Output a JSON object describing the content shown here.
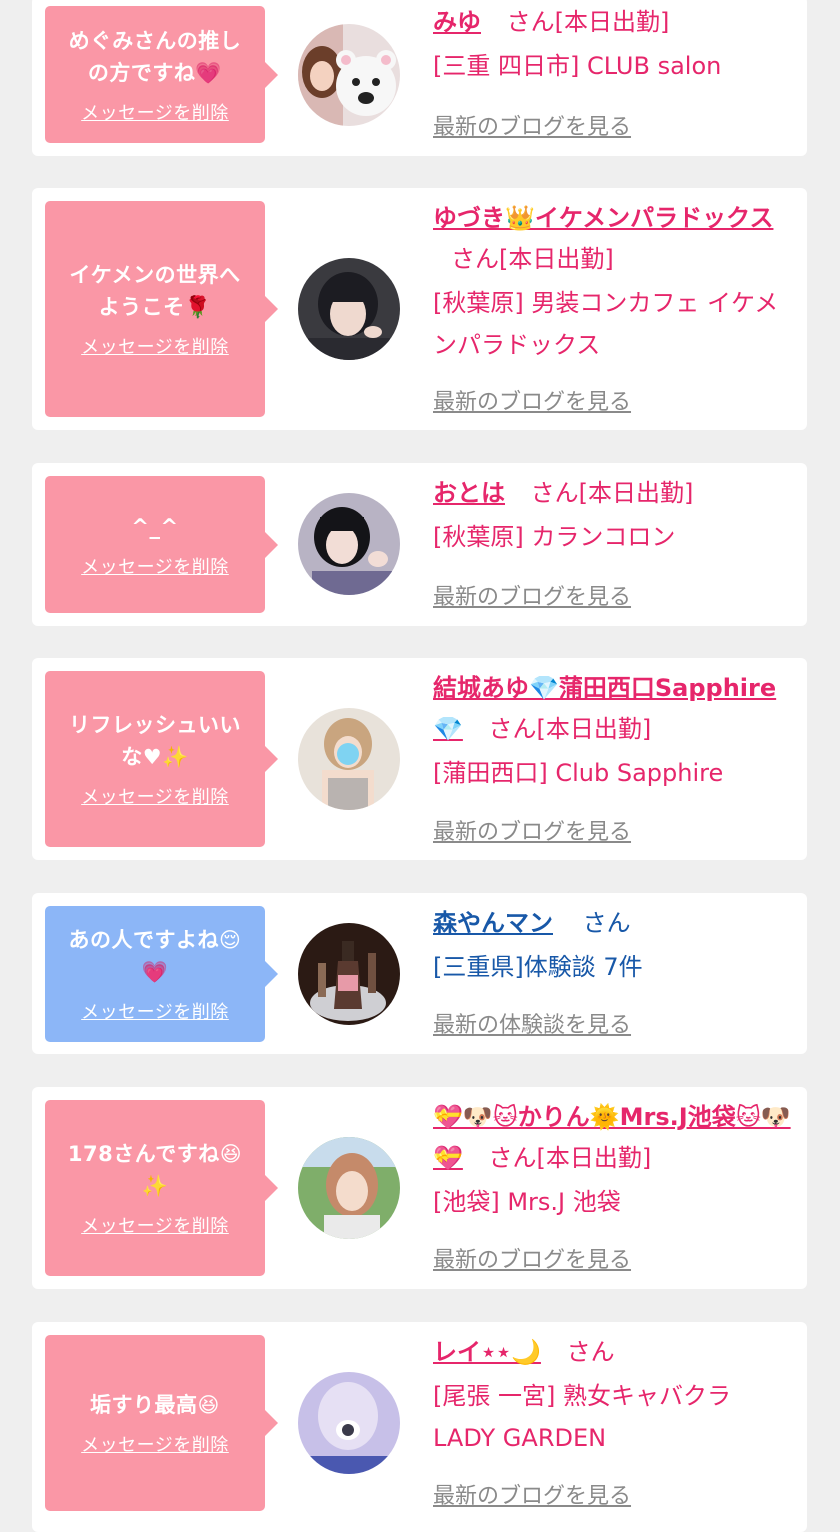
{
  "colors": {
    "pink_bubble": "#fa97a6",
    "blue_bubble": "#8cb6f7",
    "cast_name": "#e6266b",
    "user_name": "#1858a8",
    "link_gray": "#8a8a8a"
  },
  "delete_label": "メッセージを削除",
  "cards": [
    {
      "message": [
        "めぐみさんの推し",
        "の方ですね💗"
      ],
      "name": "みゆ",
      "name_suffix": "さん[本日出勤]",
      "shop": "[三重 四日市] CLUB salon",
      "link": "最新のブログを見る",
      "avatar_icon": "woman-and-bear-photo-icon"
    },
    {
      "message": [
        "イケメンの世界へ",
        "ようこそ🌹"
      ],
      "name": "ゆづき👑イケメンパラドックス",
      "name_suffix": "さん[本日出勤]",
      "shop": "[秋葉原] 男装コンカフェ イケメンパラドックス",
      "link": "最新のブログを見る",
      "avatar_icon": "short-hair-person-photo-icon"
    },
    {
      "message": [
        "^_^"
      ],
      "name": "おとは",
      "name_suffix": "さん[本日出勤]",
      "shop": "[秋葉原] カランコロン",
      "link": "最新のブログを見る",
      "avatar_icon": "girl-photo-icon"
    },
    {
      "message": [
        "リフレッシュいい",
        "な♥✨"
      ],
      "name": "結城あゆ💎蒲田西口Sapphire💎",
      "name_suffix": "さん[本日出勤]",
      "shop": "[蒲田西口] Club Sapphire",
      "link": "最新のブログを見る",
      "avatar_icon": "woman-photo-icon"
    },
    {
      "message": [
        "あの人ですよね😌",
        "💗"
      ],
      "name": "森やんマン",
      "name_suffix": "さん",
      "shop": "[三重県]体験談 7件",
      "link": "最新の体験談を見る",
      "avatar_icon": "champagne-photo-icon"
    },
    {
      "message": [
        "178さんですね😆",
        "✨"
      ],
      "name": "💝🐶🐱かりん🌞Mrs.J池袋🐱🐶💝",
      "name_suffix": "さん[本日出勤]",
      "shop": "[池袋] Mrs.J 池袋",
      "link": "最新のブログを見る",
      "avatar_icon": "woman-outdoors-photo-icon"
    },
    {
      "message": [
        "垢すり最高😆"
      ],
      "name": "レイ⋆⋆🌙",
      "name_suffix": "さん",
      "shop": "[尾張 一宮] 熟女キャバクラ LADY GARDEN",
      "link": "最新のブログを見る",
      "avatar_icon": "blurred-woman-photo-icon"
    }
  ]
}
